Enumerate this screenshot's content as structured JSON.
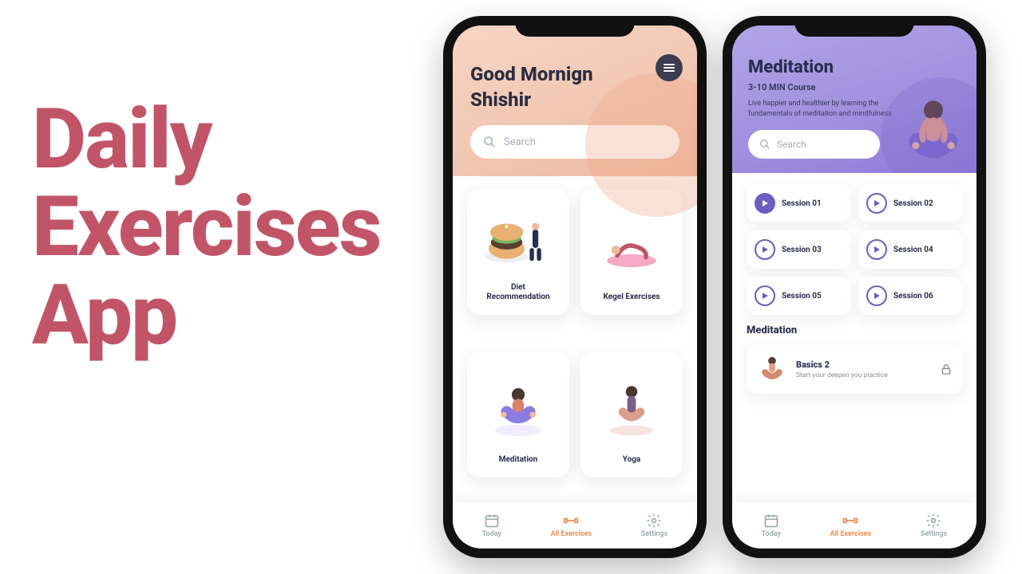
{
  "hero": {
    "line1": "Daily",
    "line2": "Exercises",
    "line3": "App"
  },
  "colors": {
    "accent": "#c15567",
    "nav_active": "#e8864a",
    "purple": "#6b5ebf"
  },
  "phone1": {
    "greeting_line1": "Good Mornign",
    "greeting_line2": "Shishir",
    "search_placeholder": "Search",
    "cards": [
      {
        "label": "Diet\nRecommendation"
      },
      {
        "label": "Kegel Exercises"
      },
      {
        "label": "Meditation"
      },
      {
        "label": "Yoga"
      }
    ]
  },
  "phone2": {
    "title": "Meditation",
    "subtitle": "3-10 MIN Course",
    "description": "Live happier and healthier by learning the fundamentals of meditation and mindfulness",
    "search_placeholder": "Search",
    "sessions": [
      {
        "label": "Session 01",
        "active": true
      },
      {
        "label": "Session 02",
        "active": false
      },
      {
        "label": "Session 03",
        "active": false
      },
      {
        "label": "Session 04",
        "active": false
      },
      {
        "label": "Session 05",
        "active": false
      },
      {
        "label": "Session 06",
        "active": false
      }
    ],
    "section_title": "Meditation",
    "basics_card": {
      "title": "Basics 2",
      "subtitle": "Start your deepen you practice"
    }
  },
  "nav": {
    "items": [
      {
        "label": "Today"
      },
      {
        "label": "All Exercises"
      },
      {
        "label": "Settings"
      }
    ]
  }
}
